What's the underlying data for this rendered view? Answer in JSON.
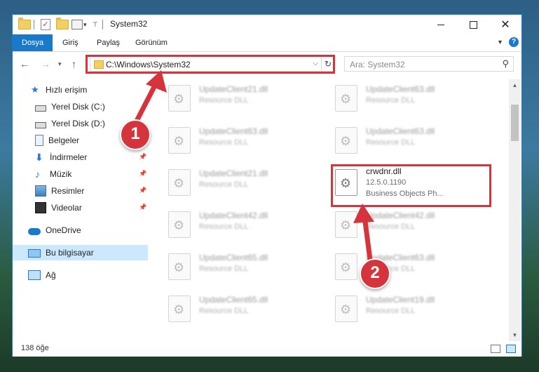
{
  "window": {
    "title": "System32",
    "min_label": "",
    "max_label": "",
    "close_label": "✕"
  },
  "ribbon": {
    "tabs": [
      "Dosya",
      "Giriş",
      "Paylaş",
      "Görünüm"
    ],
    "help": "?"
  },
  "address": {
    "path": "C:\\Windows\\System32",
    "search_placeholder": "Ara: System32"
  },
  "nav": {
    "quick_access": "Hızlı erişim",
    "items": [
      "Yerel Disk (C:)",
      "Yerel Disk (D:)",
      "Belgeler",
      "İndirmeler",
      "Müzik",
      "Resimler",
      "Videolar"
    ],
    "onedrive": "OneDrive",
    "this_pc": "Bu bilgisayar",
    "network": "Ağ"
  },
  "files": {
    "left_column": [
      {
        "name": "UpdateClient21.dll",
        "type": "Resource DLL"
      },
      {
        "name": "UpdateClient63.dll",
        "type": "Resource DLL"
      },
      {
        "name": "UpdateClient21.dll",
        "type": "Resource DLL"
      },
      {
        "name": "UpdateClient42.dll",
        "type": "Resource DLL"
      },
      {
        "name": "UpdateClient65.dll",
        "type": "Resource DLL"
      },
      {
        "name": "UpdateClient65.dll",
        "type": "Resource DLL"
      }
    ],
    "right_column": [
      {
        "name": "UpdateClient63.dll",
        "type": "Resource DLL"
      },
      {
        "name": "UpdateClient63.dll",
        "type": "Resource DLL"
      },
      {
        "name": "UpdateClient42.dll",
        "type": "Resource DLL"
      },
      {
        "name": "UpdateClient63.dll",
        "type": "Resource DLL"
      },
      {
        "name": "UpdateClient19.dll",
        "type": "Resource DLL"
      }
    ],
    "highlighted": {
      "name": "crwdnr.dll",
      "version": "12.5.0.1190",
      "company": "Business Objects Ph..."
    }
  },
  "status": {
    "count": "138 öğe"
  },
  "annotations": {
    "step1": "1",
    "step2": "2",
    "color": "#d6343c"
  }
}
